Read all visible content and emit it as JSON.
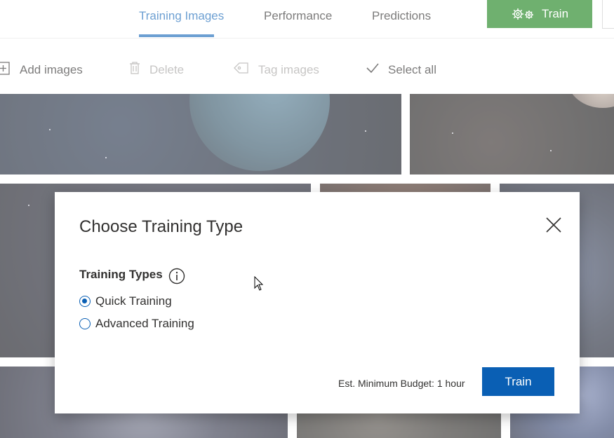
{
  "tabs": [
    {
      "label": "Training Images",
      "active": true
    },
    {
      "label": "Performance",
      "active": false
    },
    {
      "label": "Predictions",
      "active": false
    }
  ],
  "top_train_button": {
    "label": "Train",
    "icon": "gears-icon",
    "color": "#107c10"
  },
  "toolbar": {
    "add_images": {
      "label": "Add images",
      "icon": "add-image-icon",
      "enabled": true
    },
    "delete": {
      "label": "Delete",
      "icon": "trash-icon",
      "enabled": false
    },
    "tag_images": {
      "label": "Tag images",
      "icon": "tag-icon",
      "enabled": false
    },
    "select_all": {
      "label": "Select all",
      "icon": "checkmark-icon",
      "enabled": true
    }
  },
  "dialog": {
    "title": "Choose Training Type",
    "section_label": "Training Types",
    "options": [
      {
        "label": "Quick Training",
        "selected": true
      },
      {
        "label": "Advanced Training",
        "selected": false
      }
    ],
    "budget_text": "Est. Minimum Budget: 1 hour",
    "train_button": "Train"
  },
  "colors": {
    "accent": "#0a5fb4",
    "train_green": "#107c10"
  }
}
